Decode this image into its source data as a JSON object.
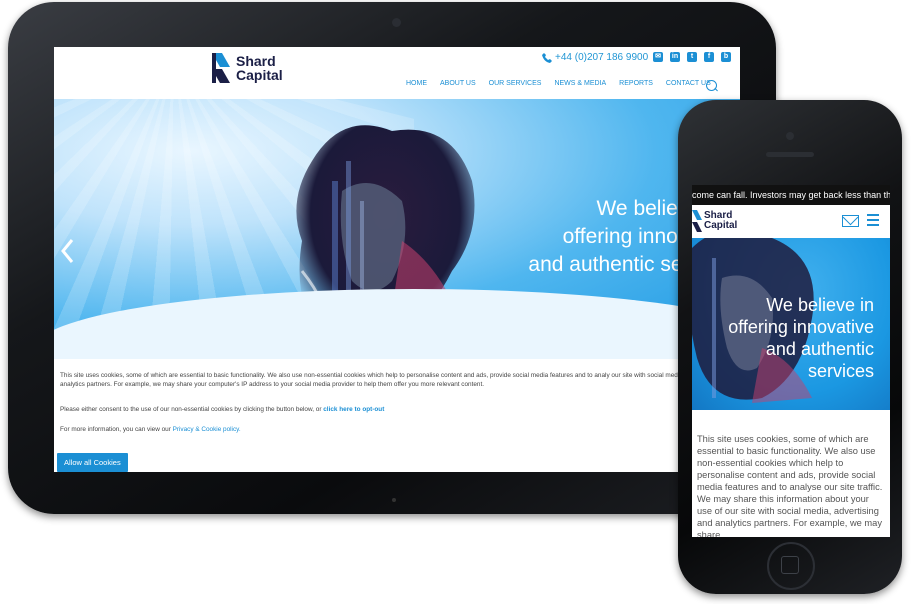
{
  "tablet": {
    "brand": {
      "line1": "Shard",
      "line2": "Capital"
    },
    "phone_number": "+44 (0)207 186 9900",
    "social_icons": [
      "email-icon",
      "linkedin-icon",
      "twitter-icon",
      "facebook-icon",
      "blog-icon"
    ],
    "social_glyphs": {
      "email": "✉",
      "linkedin": "in",
      "twitter": "t",
      "facebook": "f",
      "blog": "b"
    },
    "nav": [
      "HOME",
      "ABOUT US",
      "OUR SERVICES",
      "NEWS & MEDIA",
      "REPORTS",
      "CONTACT US"
    ],
    "hero": {
      "line1": "We believe",
      "line2": "offering innova",
      "line3": "and authentic serv"
    },
    "cookie": {
      "paragraph1": "This site uses cookies, some of which are essential to basic functionality. We also use non-essential cookies which help to personalise content and ads, provide social media features and to analy our site with social media, advertising and analytics partners. For example, we may share your computer's IP address to your social media provider to help them offer you more relevant content.",
      "paragraph2_prefix": "Please either consent to the use of our non-essential cookies by clicking the button below, or ",
      "paragraph2_link": "click here to opt-out",
      "paragraph3_prefix": "For more information, you can view our ",
      "paragraph3_link": "Privacy & Cookie policy.",
      "allow_button": "Allow all Cookies"
    }
  },
  "phone": {
    "ticker": "come can fall. Investors may get back less than they",
    "brand": {
      "line1": "Shard",
      "line2": "Capital"
    },
    "hero": {
      "line1": "We believe in",
      "line2": "offering innovative",
      "line3": "and authentic",
      "line4": "services"
    },
    "cookie_text": "This site uses cookies, some of which are essential to basic functionality. We also use non-essential cookies which help to personalise content and ads, provide social media features and to analyse our site traffic. We may share this information about your use of our site with social media, advertising and analytics partners. For example, we may share"
  },
  "colors": {
    "accent": "#1b8fd4",
    "brand_navy": "#1b1f46",
    "device_frame": "#0a0b0d"
  }
}
